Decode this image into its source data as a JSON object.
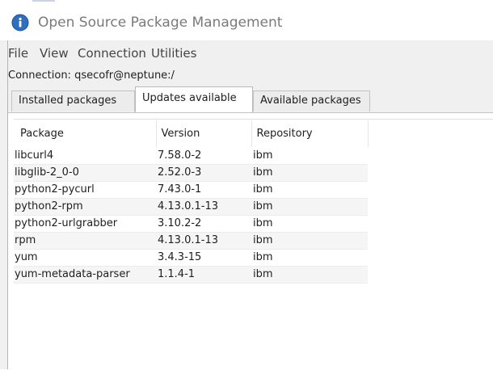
{
  "window": {
    "title": "Open Source Package Management"
  },
  "menu": {
    "items": [
      "File",
      "View",
      "Connection",
      "Utilities"
    ]
  },
  "connection": {
    "label": "Connection: qsecofr@neptune:/"
  },
  "tabs": [
    {
      "label": "Installed packages",
      "active": false
    },
    {
      "label": "Updates available",
      "active": true
    },
    {
      "label": "Available packages",
      "active": false
    }
  ],
  "table": {
    "columns": [
      "Package",
      "Version",
      "Repository"
    ],
    "rows": [
      [
        "libcurl4",
        "7.58.0-2",
        "ibm"
      ],
      [
        "libglib-2_0-0",
        "2.52.0-3",
        "ibm"
      ],
      [
        "python2-pycurl",
        "7.43.0-1",
        "ibm"
      ],
      [
        "python2-rpm",
        "4.13.0.1-13",
        "ibm"
      ],
      [
        "python2-urlgrabber",
        "3.10.2-2",
        "ibm"
      ],
      [
        "rpm",
        "4.13.0.1-13",
        "ibm"
      ],
      [
        "yum",
        "3.4.3-15",
        "ibm"
      ],
      [
        "yum-metadata-parser",
        "1.1.4-1",
        "ibm"
      ]
    ]
  },
  "icons": {
    "app": "info-circle-icon"
  },
  "colors": {
    "app_icon": "#2f6fc0",
    "title_text": "#7a7a7a",
    "window_bg": "#f0f0f0"
  }
}
